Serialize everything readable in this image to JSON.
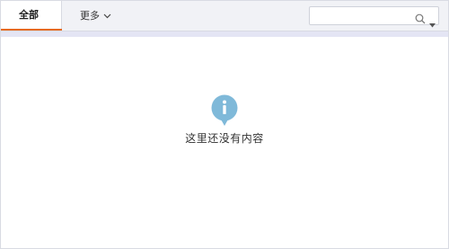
{
  "tabs": {
    "all_label": "全部",
    "more_label": "更多"
  },
  "search": {
    "placeholder": "",
    "value": ""
  },
  "empty_state": {
    "message": "这里还没有内容"
  },
  "colors": {
    "accent": "#e66a1f",
    "info_icon": "#7fb9d9",
    "topbar_bg": "#f1f2f6",
    "subbar_bg": "#e4e5f4"
  },
  "icons": {
    "more": "chevron-down-icon",
    "search": "search-icon",
    "search_options": "caret-down-icon",
    "empty": "info-icon"
  }
}
